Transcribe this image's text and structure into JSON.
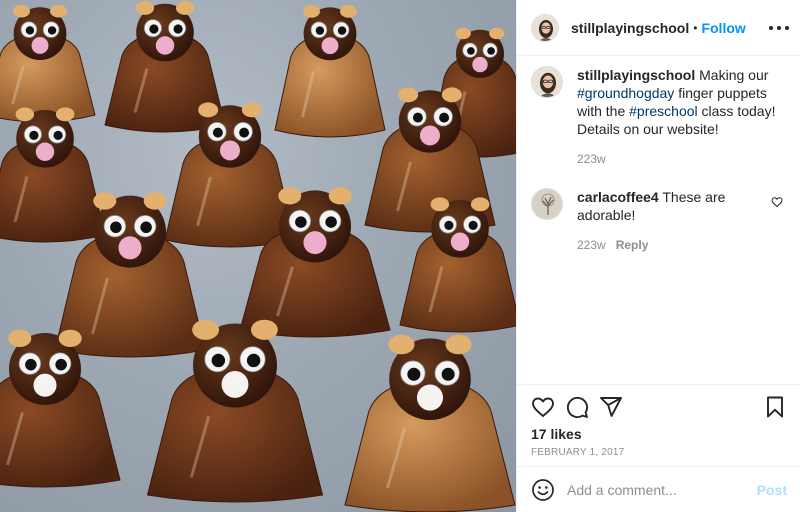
{
  "post": {
    "image_alt": "Groundhog finger puppets made from painted egg cartons with googly eyes",
    "author": {
      "username": "stillplayingschool",
      "separator": "•",
      "follow_label": "Follow"
    },
    "caption": {
      "username": "stillplayingschool",
      "text_1": " Making our ",
      "tag_1": "#groundhogday",
      "text_2": " finger puppets with the ",
      "tag_2": "#preschool",
      "text_3": " class today! Details on our website!",
      "age": "223w"
    },
    "comments": [
      {
        "username": "carlacoffee4",
        "text": " These are adorable!",
        "age": "223w",
        "reply_label": "Reply"
      }
    ],
    "likes": "17 likes",
    "date": "FEBRUARY 1, 2017",
    "add_comment": {
      "placeholder": "Add a comment...",
      "post_label": "Post"
    }
  },
  "icons": {
    "more": "more-options-icon",
    "like": "heart-icon",
    "comment": "comment-icon",
    "share": "paper-plane-icon",
    "save": "bookmark-icon",
    "emoji": "emoji-icon"
  },
  "colors": {
    "link": "#0095f6",
    "hashtag": "#00376b",
    "muted": "#8e8e8e",
    "post_disabled": "#b2dffc",
    "border": "#efefef"
  }
}
